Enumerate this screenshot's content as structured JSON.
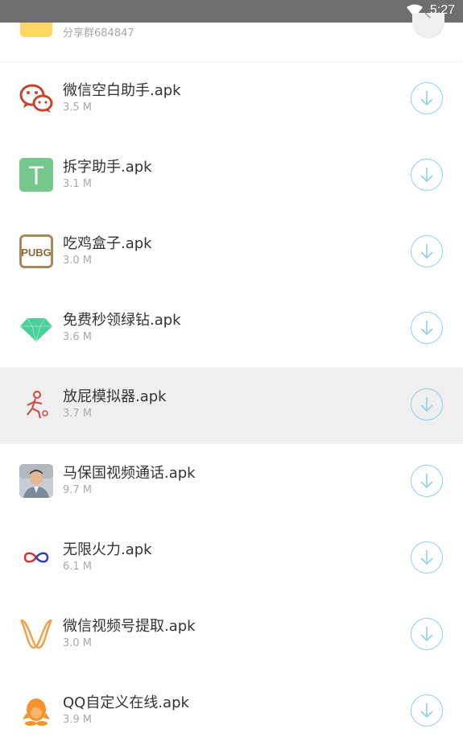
{
  "status_bar": {
    "time": "5:27"
  },
  "header": {
    "subtitle": "分享群684847"
  },
  "items": [
    {
      "name": "微信空白助手.apk",
      "size": "3.5 M",
      "icon": "wechat-icon"
    },
    {
      "name": "拆字助手.apk",
      "size": "3.1 M",
      "icon": "t-letter-icon",
      "icon_text": "T"
    },
    {
      "name": "吃鸡盒子.apk",
      "size": "3.0 M",
      "icon": "pubg-icon",
      "icon_text": "PUBG"
    },
    {
      "name": "免费秒领绿钻.apk",
      "size": "3.6 M",
      "icon": "green-diamond-icon"
    },
    {
      "name": "放屁模拟器.apk",
      "size": "3.7 M",
      "icon": "running-figure-icon"
    },
    {
      "name": "马保国视频通话.apk",
      "size": "9.7 M",
      "icon": "portrait-photo-icon"
    },
    {
      "name": "无限火力.apk",
      "size": "6.1 M",
      "icon": "infinity-icon"
    },
    {
      "name": "微信视频号提取.apk",
      "size": "3.0 M",
      "icon": "channels-logo-icon"
    },
    {
      "name": "QQ自定义在线.apk",
      "size": "3.9 M",
      "icon": "qq-penguin-icon"
    }
  ],
  "colors": {
    "accent": "#8fd1ea",
    "status_bar": "#6e6e6e",
    "highlight": "#efefef",
    "folder": "#fdd664"
  }
}
